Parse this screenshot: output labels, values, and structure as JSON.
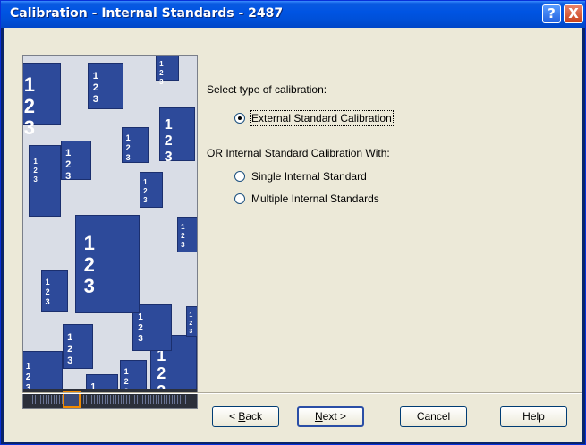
{
  "window": {
    "title": "Calibration - Internal Standards - 2487",
    "help_glyph": "?",
    "close_glyph": "X"
  },
  "illustration": {
    "name": "document-stack-illustration",
    "page_numbers": [
      "1",
      "2",
      "3"
    ]
  },
  "options": {
    "prompt": "Select type of calibration:",
    "external": {
      "label": "External Standard Calibration",
      "selected": true
    },
    "internal_prompt": "OR Internal Standard Calibration With:",
    "single": {
      "label": "Single Internal Standard",
      "selected": false
    },
    "multiple": {
      "label": "Multiple Internal Standards",
      "selected": false
    }
  },
  "buttons": {
    "back": {
      "pre": "< ",
      "key": "B",
      "post": "ack"
    },
    "next": {
      "key": "N",
      "post": "ext >"
    },
    "cancel": "Cancel",
    "help": "Help"
  },
  "colors": {
    "title_bar": "#0054e3",
    "dialog_bg": "#ece9d8",
    "doc_blue": "#2d4a9a",
    "slider_accent": "#f28a00"
  }
}
